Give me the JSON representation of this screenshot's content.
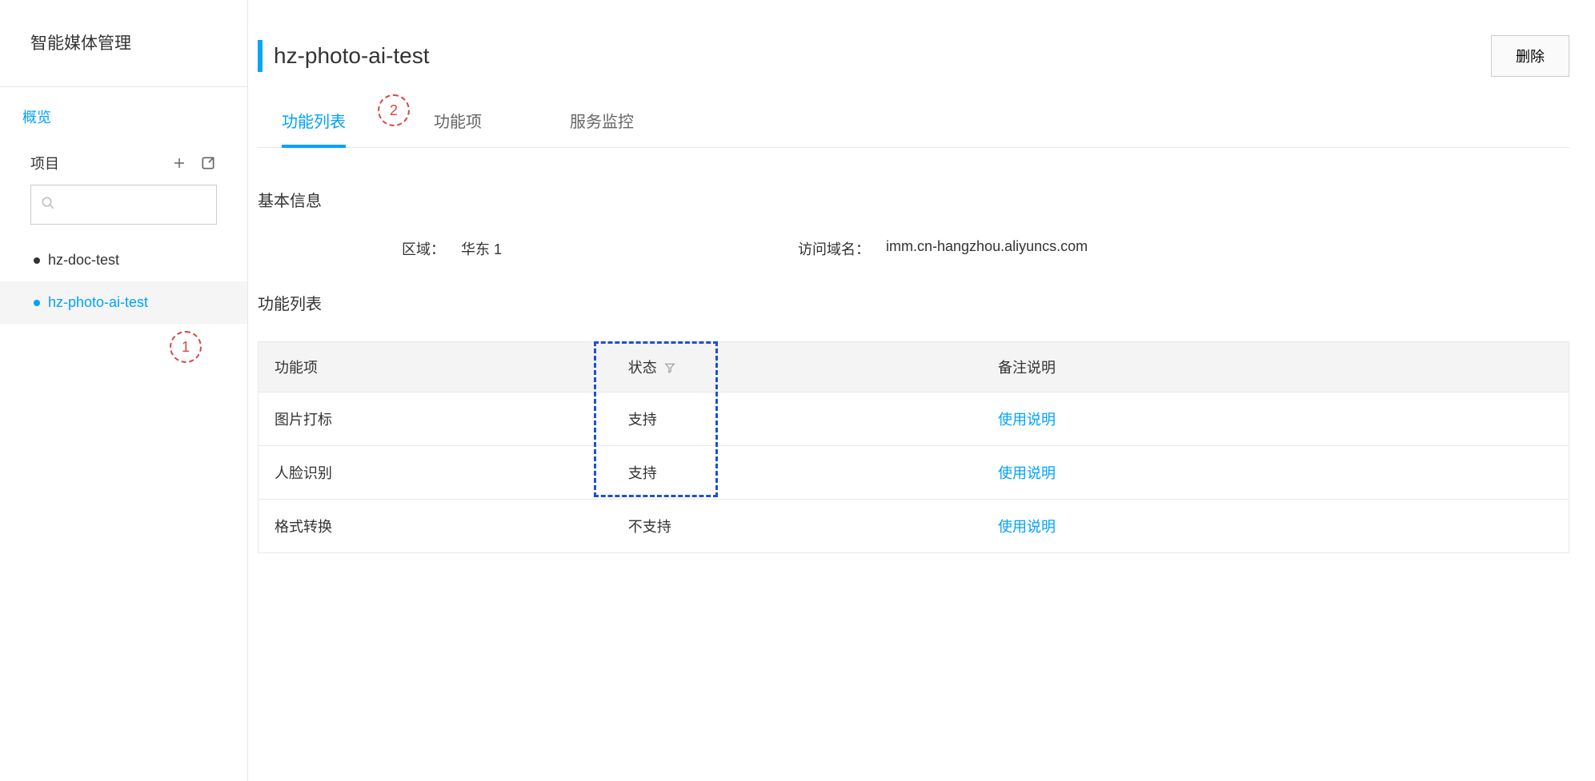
{
  "sidebar": {
    "title": "智能媒体管理",
    "overview_label": "概览",
    "project_label": "项目",
    "search_placeholder": "",
    "items": [
      {
        "label": "hz-doc-test",
        "active": false
      },
      {
        "label": "hz-photo-ai-test",
        "active": true
      }
    ]
  },
  "header": {
    "title": "hz-photo-ai-test",
    "delete_label": "删除"
  },
  "tabs": [
    {
      "label": "功能列表",
      "active": true
    },
    {
      "label": "功能项",
      "active": false
    },
    {
      "label": "服务监控",
      "active": false
    }
  ],
  "basic_info": {
    "title": "基本信息",
    "region_label": "区域：",
    "region_value": "华东 1",
    "domain_label": "访问域名：",
    "domain_value": "imm.cn-hangzhou.aliyuncs.com"
  },
  "func_list": {
    "title": "功能列表",
    "columns": {
      "feature": "功能项",
      "status": "状态",
      "remark": "备注说明"
    },
    "rows": [
      {
        "feature": "图片打标",
        "status": "支持",
        "remark": "使用说明"
      },
      {
        "feature": "人脸识别",
        "status": "支持",
        "remark": "使用说明"
      },
      {
        "feature": "格式转换",
        "status": "不支持",
        "remark": "使用说明"
      }
    ]
  },
  "annotations": {
    "a1": "1",
    "a2": "2"
  }
}
